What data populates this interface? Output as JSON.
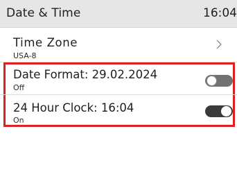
{
  "header": {
    "title": "Date & Time",
    "time": "16:04"
  },
  "settings": [
    {
      "label": "Time Zone",
      "value": "USA-8",
      "control": "chevron-right-icon"
    },
    {
      "label": "Date Format: 29.02.2024",
      "value": "Off",
      "control": "toggle",
      "enabled": false
    },
    {
      "label": "24 Hour Clock: 16:04",
      "value": "On",
      "control": "toggle",
      "enabled": true
    }
  ],
  "colors": {
    "header_bg": "#e6e6e6",
    "highlight_border": "#e02020",
    "toggle_off": "#727272",
    "toggle_on": "#3a3a3a"
  }
}
